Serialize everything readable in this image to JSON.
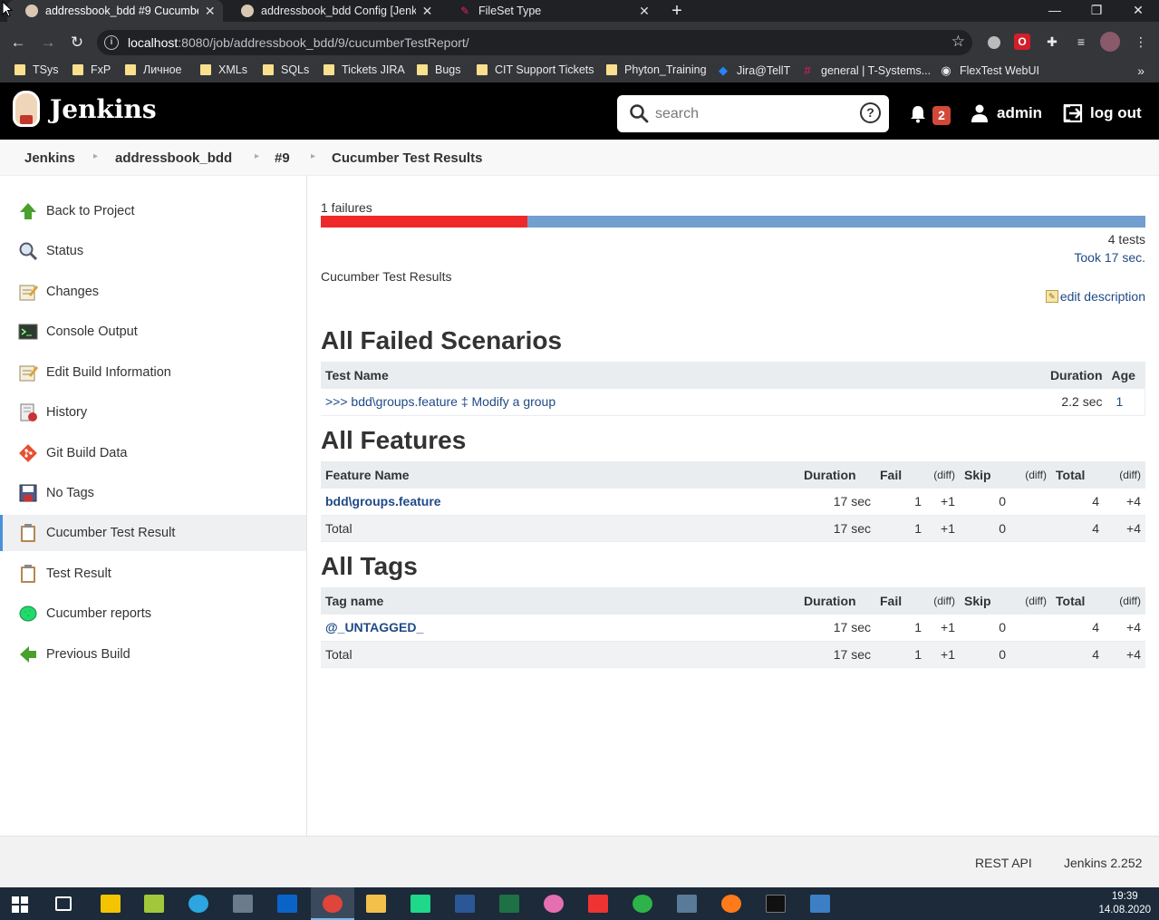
{
  "browser": {
    "tabs": [
      {
        "title": "addressbook_bdd #9 Cucumber T",
        "active": true
      },
      {
        "title": "addressbook_bdd Config [Jenkin",
        "active": false
      },
      {
        "title": "FileSet Type",
        "active": false
      }
    ],
    "url_host": "localhost",
    "url_rest": ":8080/job/addressbook_bdd/9/cucumberTestReport/",
    "bookmarks": [
      {
        "label": "TSys",
        "icon": "folder-icon"
      },
      {
        "label": "FxP",
        "icon": "folder-icon"
      },
      {
        "label": "Личное",
        "icon": "folder-icon"
      },
      {
        "label": "XMLs",
        "icon": "folder-icon"
      },
      {
        "label": "SQLs",
        "icon": "folder-icon"
      },
      {
        "label": "Tickets JIRA",
        "icon": "folder-icon"
      },
      {
        "label": "Bugs",
        "icon": "folder-icon"
      },
      {
        "label": "CIT Support Tickets",
        "icon": "folder-icon"
      },
      {
        "label": "Phyton_Training",
        "icon": "folder-icon"
      },
      {
        "label": "Jira@TellT",
        "icon": "jira-icon"
      },
      {
        "label": "general | T-Systems...",
        "icon": "slack-icon"
      },
      {
        "label": "FlexTest WebUI",
        "icon": "globe-icon"
      }
    ]
  },
  "header": {
    "logo_text": "Jenkins",
    "search_placeholder": "search",
    "notifications_count": "2",
    "user": "admin",
    "logout": "log out"
  },
  "breadcrumb": [
    "Jenkins",
    "addressbook_bdd",
    "#9",
    "Cucumber Test Results"
  ],
  "sidebar": {
    "items": [
      {
        "label": "Back to Project",
        "icon": "up-arrow-icon"
      },
      {
        "label": "Status",
        "icon": "magnifier-icon"
      },
      {
        "label": "Changes",
        "icon": "notepad-icon"
      },
      {
        "label": "Console Output",
        "icon": "terminal-icon"
      },
      {
        "label": "Edit Build Information",
        "icon": "notepad-icon"
      },
      {
        "label": "History",
        "icon": "history-icon"
      },
      {
        "label": "Git Build Data",
        "icon": "git-icon"
      },
      {
        "label": "No Tags",
        "icon": "save-icon"
      },
      {
        "label": "Cucumber Test Result",
        "icon": "clipboard-icon",
        "active": true
      },
      {
        "label": "Test Result",
        "icon": "clipboard-icon"
      },
      {
        "label": "Cucumber reports",
        "icon": "cucumber-icon"
      },
      {
        "label": "Previous Build",
        "icon": "left-arrow-icon"
      }
    ]
  },
  "summary": {
    "failures_label": "1 failures",
    "fail_ratio": 0.25,
    "tests": "4 tests",
    "took": "Took 17 sec.",
    "description": "Cucumber Test Results",
    "edit_description": "edit description"
  },
  "failed_scenarios": {
    "title": "All Failed Scenarios",
    "headers": [
      "Test Name",
      "Duration",
      "Age"
    ],
    "rows": [
      {
        "name": ">>> bdd\\groups.feature ‡ Modify a group",
        "duration": "2.2 sec",
        "age": "1"
      }
    ]
  },
  "features": {
    "title": "All Features",
    "headers": [
      "Feature Name",
      "Duration",
      "Fail",
      "(diff)",
      "Skip",
      "(diff)",
      "Total",
      "(diff)"
    ],
    "rows": [
      {
        "name": "bdd\\groups.feature",
        "duration": "17 sec",
        "fail": "1",
        "fail_diff": "+1",
        "skip": "0",
        "skip_diff": "",
        "total": "4",
        "total_diff": "+4"
      },
      {
        "name": "Total",
        "duration": "17 sec",
        "fail": "1",
        "fail_diff": "+1",
        "skip": "0",
        "skip_diff": "",
        "total": "4",
        "total_diff": "+4"
      }
    ]
  },
  "tags": {
    "title": "All Tags",
    "headers": [
      "Tag name",
      "Duration",
      "Fail",
      "(diff)",
      "Skip",
      "(diff)",
      "Total",
      "(diff)"
    ],
    "rows": [
      {
        "name": "@_UNTAGGED_",
        "duration": "17 sec",
        "fail": "1",
        "fail_diff": "+1",
        "skip": "0",
        "skip_diff": "",
        "total": "4",
        "total_diff": "+4"
      },
      {
        "name": "Total",
        "duration": "17 sec",
        "fail": "1",
        "fail_diff": "+1",
        "skip": "0",
        "skip_diff": "",
        "total": "4",
        "total_diff": "+4"
      }
    ]
  },
  "footer": {
    "rest_api": "REST API",
    "version": "Jenkins 2.252"
  },
  "taskbar": {
    "time": "19:39",
    "date": "14.08.2020"
  }
}
